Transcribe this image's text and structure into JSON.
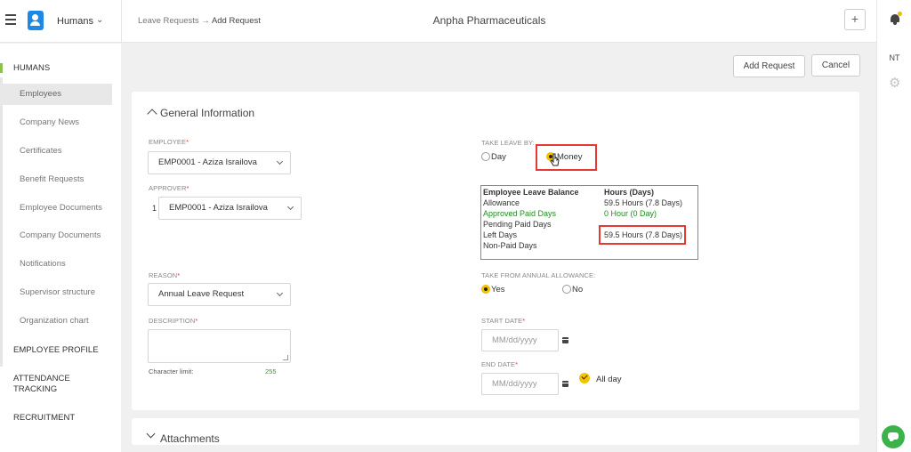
{
  "header": {
    "module": "Humans",
    "breadcrumb_parent": "Leave Requests",
    "breadcrumb_arrow": "→",
    "breadcrumb_current": "Add Request",
    "company": "Anpha Pharmaceuticals",
    "plus": "+"
  },
  "rightrail": {
    "user_initials": "NT"
  },
  "sidebar": {
    "section_humans": "HUMANS",
    "items": [
      {
        "label": "Employees"
      },
      {
        "label": "Company News"
      },
      {
        "label": "Certificates"
      },
      {
        "label": "Benefit Requests"
      },
      {
        "label": "Employee Documents"
      },
      {
        "label": "Company Documents"
      },
      {
        "label": "Notifications"
      },
      {
        "label": "Supervisor structure"
      },
      {
        "label": "Organization chart"
      }
    ],
    "section_profile": "EMPLOYEE PROFILE",
    "section_attendance": "ATTENDANCE TRACKING",
    "section_recruitment": "RECRUITMENT"
  },
  "actions": {
    "add_request": "Add Request",
    "cancel": "Cancel"
  },
  "general": {
    "title": "General Information",
    "employee_label": "EMPLOYEE",
    "employee_value": "EMP0001 - Aziza Israilova",
    "approver_label": "APPROVER",
    "approver_index": "1",
    "approver_value": "EMP0001 - Aziza Israilova",
    "reason_label": "REASON",
    "reason_value": "Annual Leave Request",
    "description_label": "DESCRIPTION",
    "char_limit_label": "Character limit:",
    "char_limit_value": "255",
    "required_mark": "*",
    "take_leave_label": "TAKE LEAVE BY:",
    "take_leave_options": [
      "Day",
      "Money"
    ],
    "take_leave_selected": "Money",
    "balance": {
      "header_left": "Employee Leave Balance",
      "header_right": "Hours (Days)",
      "rows": [
        {
          "label": "Allowance",
          "value": "59.5 Hours (7.8 Days)"
        },
        {
          "label": "Approved Paid Days",
          "value": "0 Hour (0 Day)"
        },
        {
          "label": "Pending Paid Days",
          "value": ""
        },
        {
          "label": "Left Days",
          "value": "59.5 Hours (7.8 Days)"
        },
        {
          "label": "Non-Paid Days",
          "value": ""
        }
      ]
    },
    "annual_label": "TAKE FROM ANNUAL ALLOWANCE:",
    "annual_options": [
      "Yes",
      "No"
    ],
    "annual_selected": "Yes",
    "start_label": "START DATE",
    "start_placeholder": "MM/dd/yyyy",
    "end_label": "END DATE",
    "end_placeholder": "MM/dd/yyyy",
    "all_day_label": "All day",
    "all_day_checked": true
  },
  "attachments": {
    "title": "Attachments"
  },
  "colors": {
    "accent": "#f5c400",
    "highlight": "#e53935",
    "brand": "#1e88e5",
    "active_nav": "#8bc34a"
  }
}
